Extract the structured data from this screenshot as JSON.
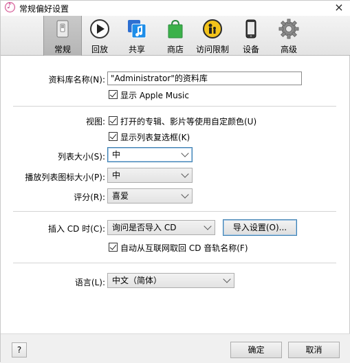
{
  "window": {
    "title": "常规偏好设置",
    "close_glyph": "×"
  },
  "toolbar": {
    "tabs": [
      {
        "label": "常规",
        "icon": "general-switch-icon"
      },
      {
        "label": "回放",
        "icon": "play-icon"
      },
      {
        "label": "共享",
        "icon": "music-note-share-icon"
      },
      {
        "label": "商店",
        "icon": "shopping-bag-icon"
      },
      {
        "label": "访问限制",
        "icon": "parental-restriction-icon"
      },
      {
        "label": "设备",
        "icon": "device-phone-icon"
      },
      {
        "label": "高级",
        "icon": "gear-icon"
      }
    ],
    "active_tab": "常规"
  },
  "library": {
    "name_label": "资料库名称(N):",
    "name_value": "\"Administrator\"的资料库",
    "show_apple_music_label": "显示 Apple Music",
    "show_apple_music_checked": true
  },
  "view": {
    "label": "视图:",
    "custom_colors_label": "打开的专辑、影片等使用自定颜色(U)",
    "custom_colors_checked": true,
    "list_checkboxes_label": "显示列表复选框(K)",
    "list_checkboxes_checked": true,
    "list_size_label": "列表大小(S):",
    "list_size_value": "中",
    "playlist_icon_size_label": "播放列表图标大小(P):",
    "playlist_icon_size_value": "中",
    "rating_label": "评分(R):",
    "rating_value": "喜爱"
  },
  "cd": {
    "insert_label": "插入 CD 时(C):",
    "insert_value": "询问是否导入 CD",
    "import_settings_button": "导入设置(O)...",
    "auto_retrieve_label": "自动从互联网取回 CD 音轨名称(F)",
    "auto_retrieve_checked": true
  },
  "language": {
    "label": "语言(L):",
    "value": "中文（简体）"
  },
  "footer": {
    "help_label": "?",
    "ok_label": "确定",
    "cancel_label": "取消"
  }
}
